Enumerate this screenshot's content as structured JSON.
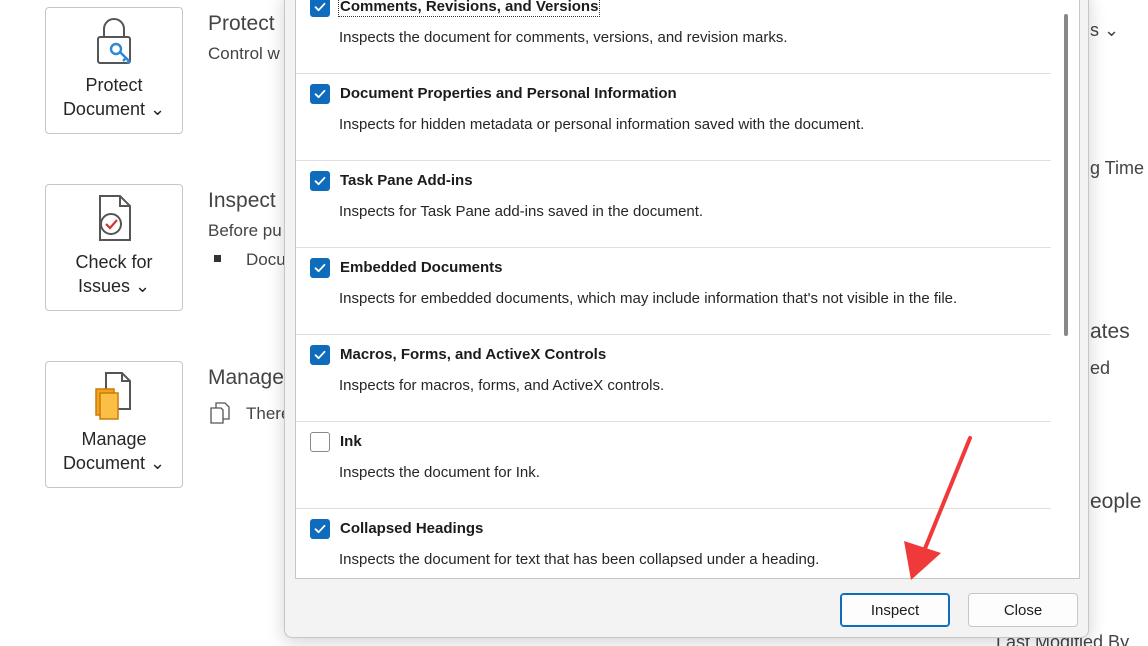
{
  "background": {
    "cards": [
      {
        "label": "Protect\nDocument ⌄",
        "icon": "padlock-key-icon"
      },
      {
        "label": "Check for\nIssues ⌄",
        "icon": "document-check-icon"
      },
      {
        "label": "Manage\nDocument ⌄",
        "icon": "document-stack-icon"
      }
    ],
    "sections": {
      "protect_heading": "Protect",
      "protect_text": "Control w",
      "inspect_heading": "Inspect",
      "inspect_text": "Before pu",
      "inspect_bullet": "Docu",
      "manage_heading": "Manage",
      "manage_text": "There"
    },
    "right_column": {
      "r1": "s ⌄",
      "r2": "g Time",
      "r3": "ates",
      "r4": "ed",
      "r5": "eople",
      "r6": "Last Modified By"
    }
  },
  "dialog": {
    "items": [
      {
        "title": "Comments, Revisions, and Versions",
        "desc": "Inspects the document for comments, versions, and revision marks.",
        "checked": true
      },
      {
        "title": "Document Properties and Personal Information",
        "desc": "Inspects for hidden metadata or personal information saved with the document.",
        "checked": true
      },
      {
        "title": "Task Pane Add-ins",
        "desc": "Inspects for Task Pane add-ins saved in the document.",
        "checked": true
      },
      {
        "title": "Embedded Documents",
        "desc": "Inspects for embedded documents, which may include information that's not visible in the file.",
        "checked": true
      },
      {
        "title": "Macros, Forms, and ActiveX Controls",
        "desc": "Inspects for macros, forms, and ActiveX controls.",
        "checked": true
      },
      {
        "title": "Ink",
        "desc": "Inspects the document for Ink.",
        "checked": false
      },
      {
        "title": "Collapsed Headings",
        "desc": "Inspects the document for text that has been collapsed under a heading.",
        "checked": true
      }
    ],
    "inspect_button": "Inspect",
    "close_button": "Close"
  },
  "colors": {
    "accent": "#0f6cbd",
    "arrow": "#f03a3a"
  }
}
